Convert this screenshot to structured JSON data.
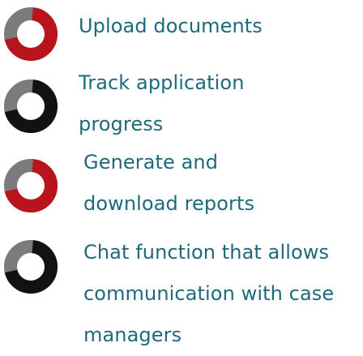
{
  "features": [
    {
      "label_lines": [
        "Upload documents"
      ],
      "icon": "donut-ring-icon",
      "ring_colors": {
        "main": "#b8141c",
        "accent": "#7b7b7b"
      }
    },
    {
      "label_lines": [
        "Track application",
        "progress"
      ],
      "icon": "donut-ring-icon",
      "ring_colors": {
        "main": "#121212",
        "accent": "#7b7b7b"
      }
    },
    {
      "label_lines": [
        "Generate and",
        "download reports"
      ],
      "icon": "donut-ring-icon",
      "ring_colors": {
        "main": "#b8141c",
        "accent": "#7b7b7b"
      }
    },
    {
      "label_lines": [
        "Chat function that allows",
        "communication with case",
        "managers"
      ],
      "icon": "donut-ring-icon",
      "ring_colors": {
        "main": "#121212",
        "accent": "#7b7b7b"
      }
    }
  ],
  "colors": {
    "text": "#1d6a7d"
  }
}
